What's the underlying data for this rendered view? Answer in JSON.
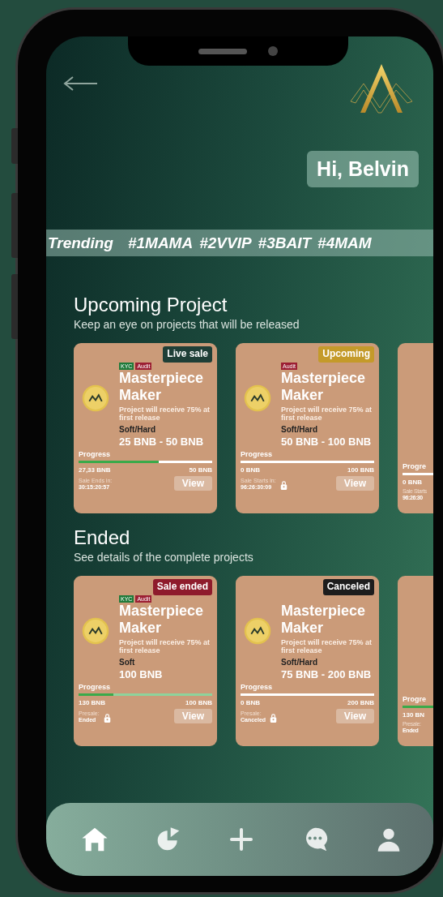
{
  "header": {
    "greeting": "Hi, Belvin"
  },
  "trending": {
    "label": "Trending",
    "tags": [
      "#1MAMA",
      "#2VVIP",
      "#3BAIT",
      "#4MAM"
    ]
  },
  "sections": [
    {
      "title": "Upcoming Project",
      "subtitle": "Keep an eye on projects that will be released",
      "cards": [
        {
          "kind": "full",
          "status": "Live sale",
          "color": "#1f3f37",
          "kyc": "KYC",
          "audit": "Audit",
          "name": "Masterpiece Maker",
          "description": "Project will receive 75% at first release",
          "cap_label": "Soft/Hard",
          "cap": "25 BNB - 50 BNB",
          "progress_label": "Progress",
          "level": 0.6,
          "goal_reached": false,
          "raised": "27,33 BNB",
          "target": "50 BNB",
          "timer_label": "Sale Ends in:",
          "timer": "30:15:20:57",
          "locked": false,
          "button": "View"
        },
        {
          "kind": "full",
          "status": "Upcoming",
          "color": "#c49a2a",
          "audit": "Audit",
          "name": "Masterpiece Maker",
          "description": "Project will receive 75% at first release",
          "cap_label": "Soft/Hard",
          "cap": "50 BNB - 100 BNB",
          "progress_label": "Progress",
          "level": 0,
          "goal_reached": false,
          "raised": "0 BNB",
          "target": "100 BNB",
          "timer_label": "Sale Starts in:",
          "timer": "96:26:30:09",
          "locked": true,
          "button": "View"
        },
        {
          "kind": "peek",
          "progress_label": "Progre",
          "level": 0,
          "goal_reached": false,
          "raised": "0 BNB",
          "timer_label": "Sale Starts",
          "timer": "96:26:30"
        }
      ]
    },
    {
      "title": "Ended",
      "subtitle": "See details of the complete projects",
      "cards": [
        {
          "kind": "full",
          "status": "Sale ended",
          "color": "#8e1b2c",
          "kyc": "KYC",
          "audit": "Audit",
          "name": "Masterpiece Maker",
          "description": "Project will receive 75% at first release",
          "cap_label": "Soft",
          "cap": "100 BNB",
          "progress_label": "Progress",
          "level": 0.26,
          "goal_reached": true,
          "raised": "130 BNB",
          "target": "100 BNB",
          "timer_label": "Presale:",
          "timer": "Ended",
          "locked": true,
          "button": "View"
        },
        {
          "kind": "full",
          "status": "Canceled",
          "color": "#1d1d1d",
          "name": "Masterpiece Maker",
          "description": "Project will receive 75% at first release",
          "cap_label": "Soft/Hard",
          "cap": "75 BNB - 200 BNB",
          "progress_label": "Progress",
          "level": 0,
          "goal_reached": false,
          "raised": "0 BNB",
          "target": "200 BNB",
          "timer_label": "Presale:",
          "timer": "Canceled",
          "locked": true,
          "button": "View"
        },
        {
          "kind": "peek",
          "progress_label": "Progre",
          "level": 0.26,
          "goal_reached": true,
          "raised": "130 BN",
          "timer_label": "Presale:",
          "timer": "Ended"
        }
      ]
    }
  ],
  "nav": [
    {
      "kind": "home",
      "selected": true
    },
    {
      "kind": "chart"
    },
    {
      "kind": "add"
    },
    {
      "kind": "chat"
    },
    {
      "kind": "profile"
    }
  ]
}
